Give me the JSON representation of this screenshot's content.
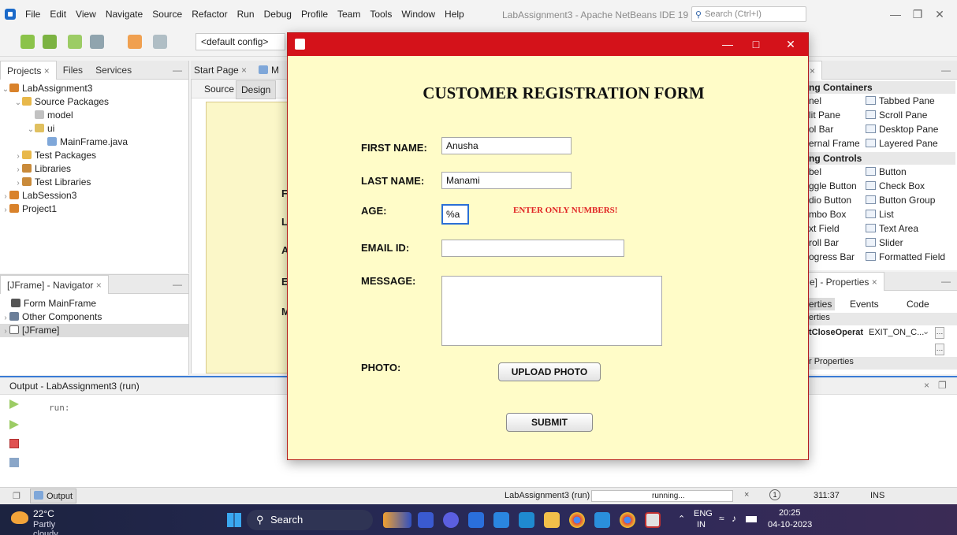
{
  "ide": {
    "menu": [
      "File",
      "Edit",
      "View",
      "Navigate",
      "Source",
      "Refactor",
      "Run",
      "Debug",
      "Profile",
      "Team",
      "Tools",
      "Window",
      "Help"
    ],
    "window_title": "LabAssignment3 - Apache NetBeans IDE 19",
    "search_placeholder": "Search (Ctrl+I)",
    "config": "<default config>"
  },
  "projects_panel": {
    "tabs": [
      "Projects",
      "Files",
      "Services"
    ],
    "tree": [
      {
        "label": "LabAssignment3"
      },
      {
        "label": "Source Packages"
      },
      {
        "label": "model"
      },
      {
        "label": "ui"
      },
      {
        "label": "MainFrame.java"
      },
      {
        "label": "Test Packages"
      },
      {
        "label": "Libraries"
      },
      {
        "label": "Test Libraries"
      },
      {
        "label": "LabSession3"
      },
      {
        "label": "Project1"
      }
    ]
  },
  "navigator_panel": {
    "title": "[JFrame] - Navigator",
    "items": [
      "Form MainFrame",
      "Other Components",
      "[JFrame]"
    ]
  },
  "editor": {
    "tab_start": "Start Page",
    "tab_file_prefix": "M",
    "subtabs": [
      "Source",
      "Design"
    ],
    "canvas_letters": [
      "F",
      "L",
      "A",
      "E",
      "M"
    ]
  },
  "palette": {
    "tab_close": "×",
    "section_containers": "ng Containers",
    "containers_left": [
      "nel",
      "lit Pane",
      "ol Bar",
      "ernal Frame"
    ],
    "containers_right": [
      "Tabbed Pane",
      "Scroll Pane",
      "Desktop Pane",
      "Layered Pane"
    ],
    "section_controls": "ng Controls",
    "controls_left": [
      "bel",
      "ggle Button",
      "dio Button",
      "mbo Box",
      "xt Field",
      "roll Bar",
      "ogress Bar"
    ],
    "controls_right": [
      "Button",
      "Check Box",
      "Button Group",
      "List",
      "Text Area",
      "Slider",
      "Formatted Field"
    ]
  },
  "properties": {
    "title": "e] - Properties",
    "tabs": [
      "erties",
      "Events",
      "Code"
    ],
    "section": "erties",
    "prop_name": "tCloseOperat",
    "prop_value": "EXIT_ON_C...",
    "other_section": "r Properties"
  },
  "output": {
    "title": "Output - LabAssignment3 (run)",
    "text": "run:",
    "tab": "Output"
  },
  "status": {
    "task": "LabAssignment3 (run)",
    "progress": "running...",
    "position": "311:37",
    "mode": "INS"
  },
  "taskbar": {
    "weather_temp": "22°C",
    "weather_desc": "Partly cloudy",
    "search": "Search",
    "lang1": "ENG",
    "lang2": "IN",
    "time": "20:25",
    "date": "04-10-2023"
  },
  "form": {
    "title": "CUSTOMER REGISTRATION FORM",
    "first_name_label": "FIRST NAME:",
    "first_name_value": "Anusha",
    "last_name_label": "LAST NAME:",
    "last_name_value": "Manami",
    "age_label": "AGE:",
    "age_value": "%a",
    "age_warning": "ENTER ONLY NUMBERS!",
    "email_label": "EMAIL ID:",
    "email_value": "",
    "message_label": "MESSAGE:",
    "message_value": "",
    "photo_label": "PHOTO:",
    "upload_button": "UPLOAD PHOTO",
    "submit_button": "SUBMIT"
  },
  "colors": {
    "dialog_titlebar": "#d4121a",
    "form_background": "#fffcc8",
    "warning": "#e02222",
    "output_accent": "#3a7bd5"
  }
}
